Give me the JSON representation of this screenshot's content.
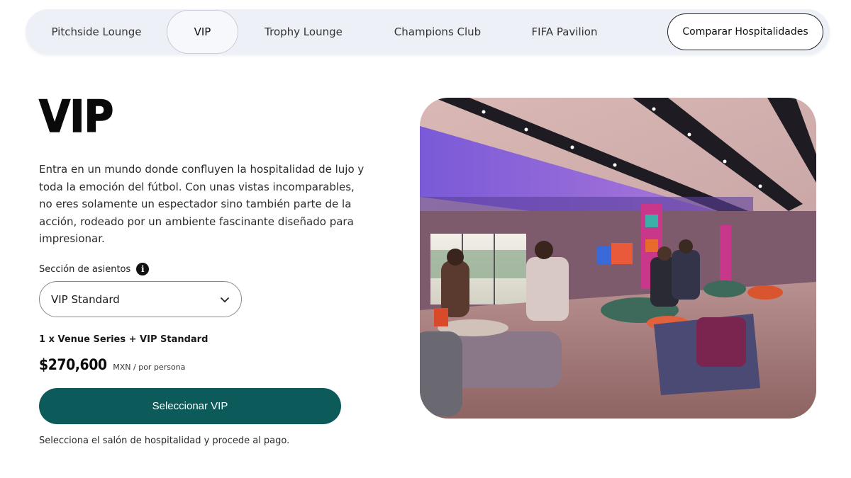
{
  "tabs": [
    {
      "label": "Pitchside Lounge",
      "active": false
    },
    {
      "label": "VIP",
      "active": true
    },
    {
      "label": "Trophy Lounge",
      "active": false
    },
    {
      "label": "Champions Club",
      "active": false
    },
    {
      "label": "FIFA Pavilion",
      "active": false
    }
  ],
  "compare_label": "Comparar Hospitalidades",
  "main": {
    "title": "VIP",
    "description": "Entra en un mundo donde confluyen la hospitalidad de lujo y toda la emoción del fútbol. Con unas vistas incomparables, no eres solamente un espectador sino también parte de la acción, rodeado por un ambiente fascinante diseñado para impresionar.",
    "seat_section_label": "Sección de asientos",
    "seat_selected": "VIP Standard",
    "package": "1 x Venue Series + VIP Standard",
    "price": "$270,600",
    "price_unit": "MXN / por persona",
    "cta_label": "Seleccionar VIP",
    "footnote": "Selecciona el salón de hospitalidad y procede al pago."
  },
  "icons": {
    "info": "info-icon",
    "chevron": "chevron-down-icon"
  },
  "colors": {
    "accent": "#0c5a5a",
    "tabbar_bg": "#eef0f8"
  }
}
